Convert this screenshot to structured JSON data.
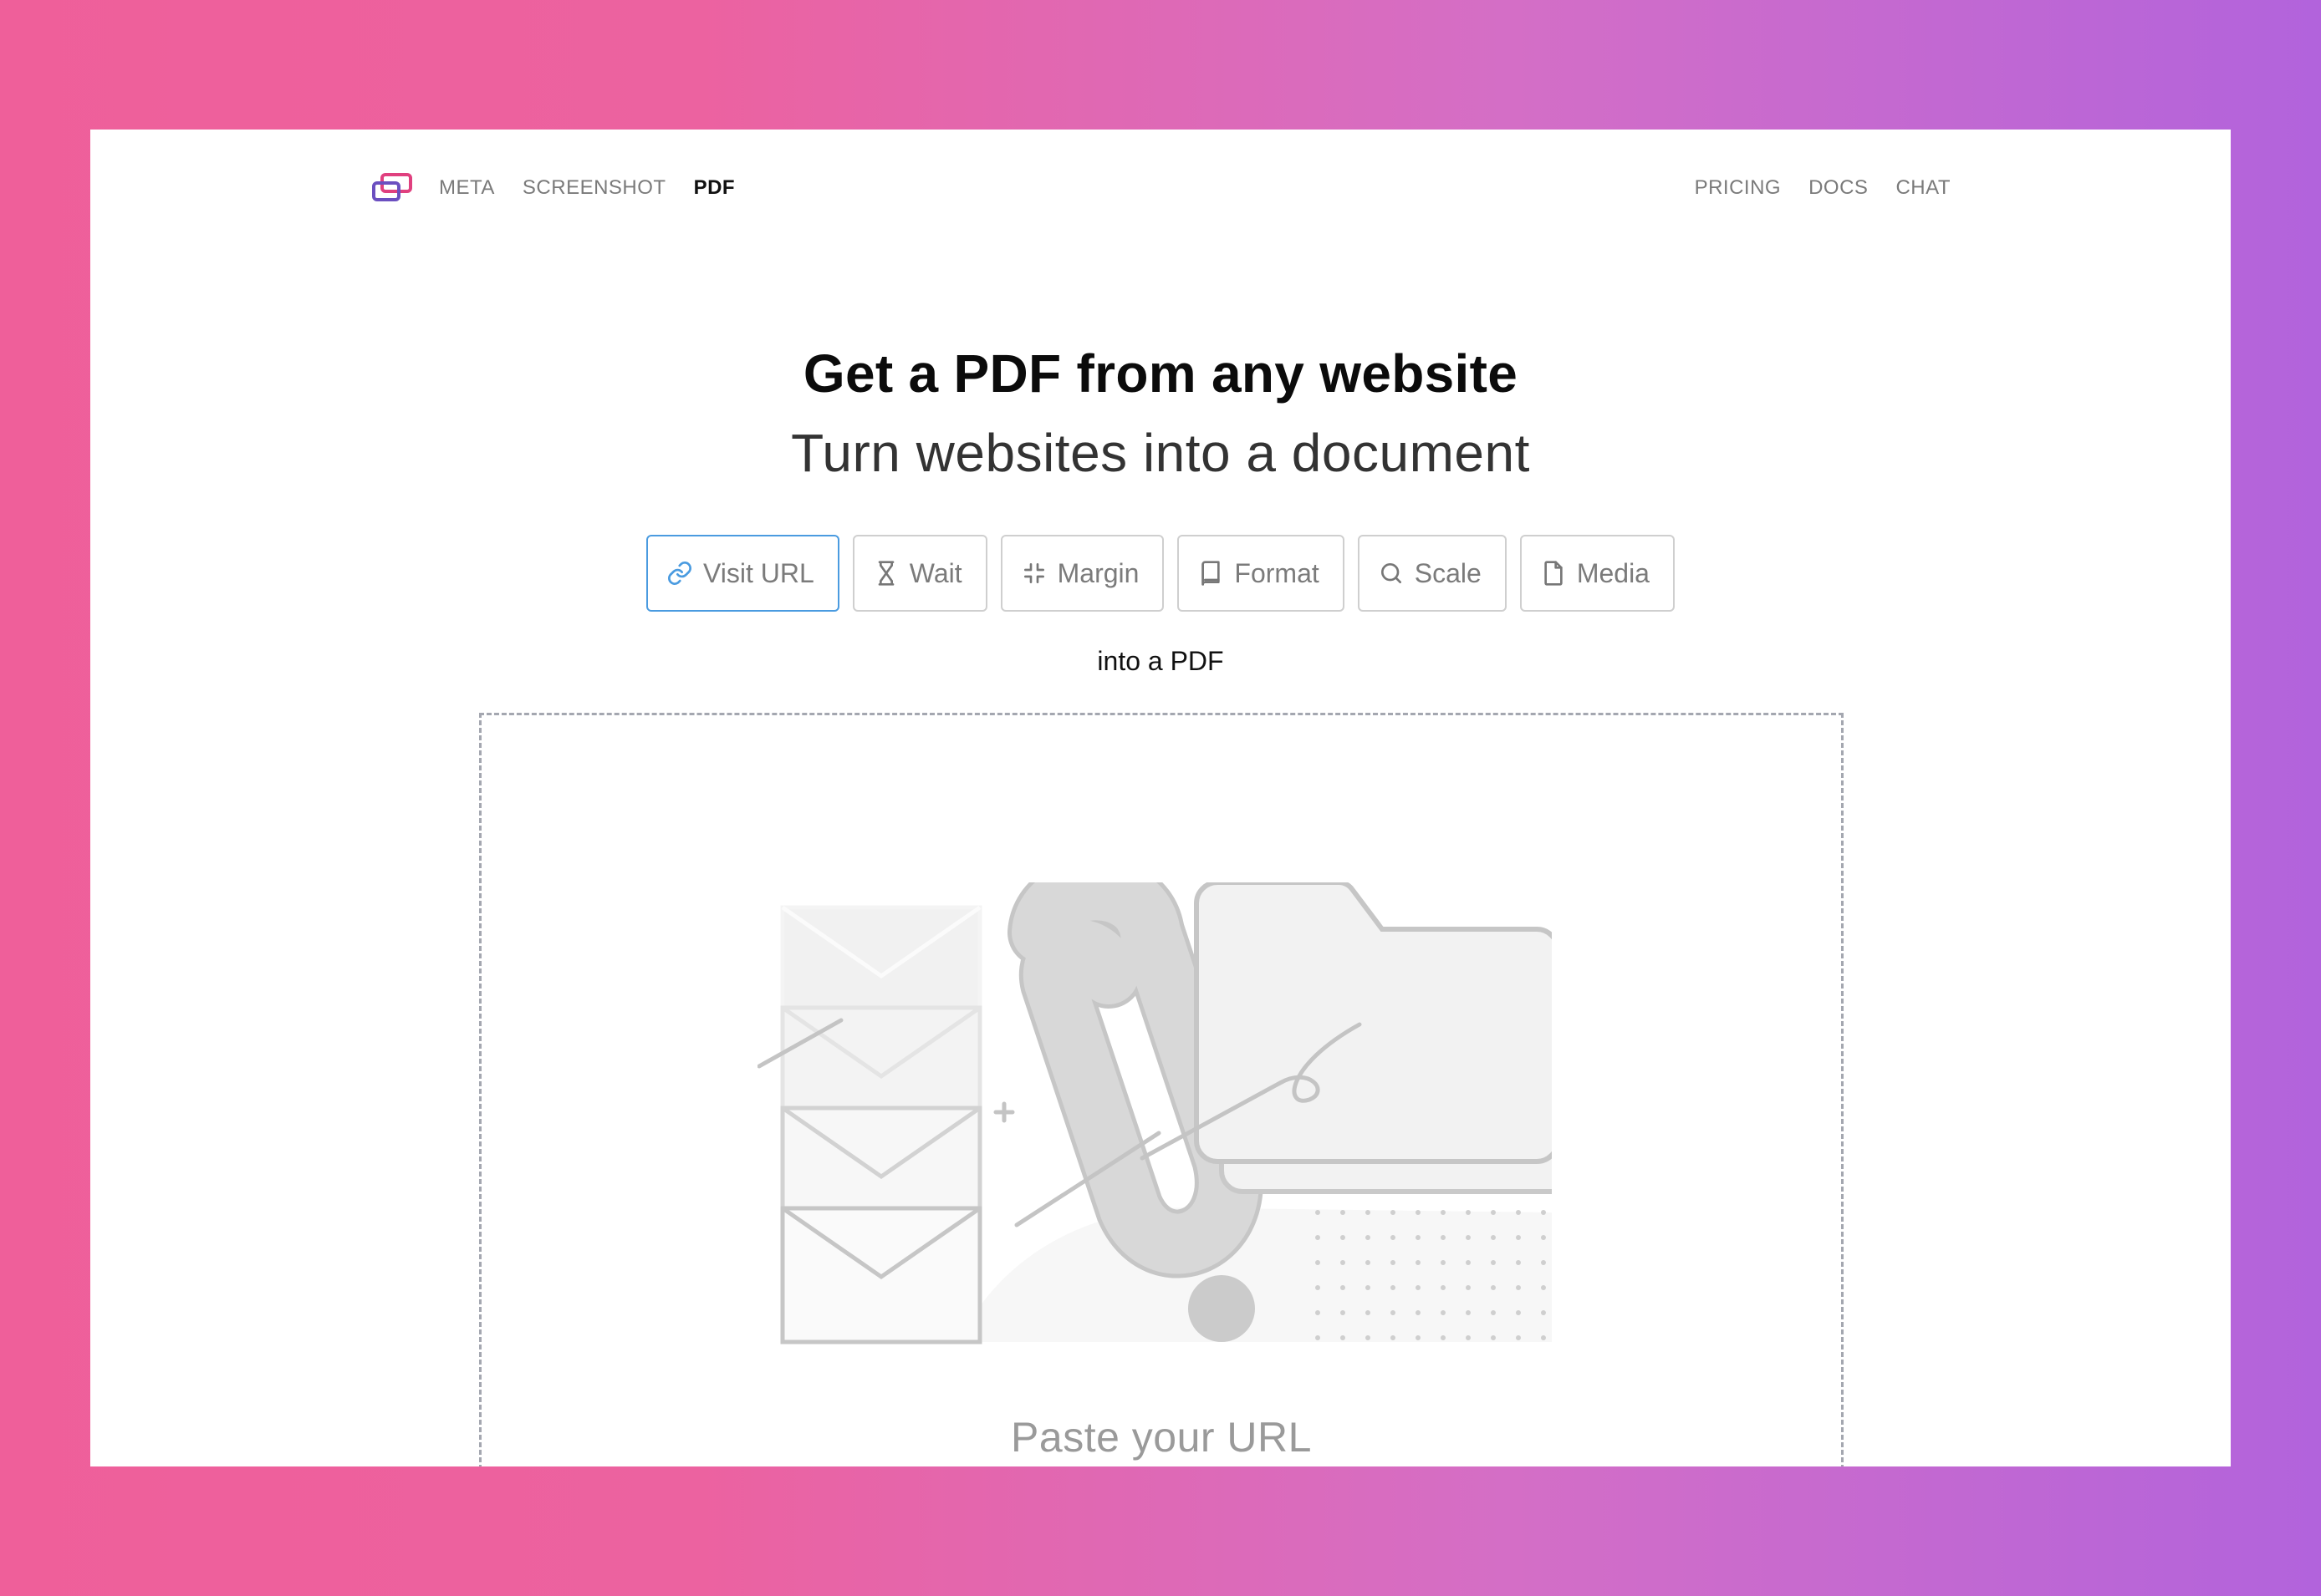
{
  "nav": {
    "left_links": [
      {
        "label": "META",
        "active": false
      },
      {
        "label": "SCREENSHOT",
        "active": false
      },
      {
        "label": "PDF",
        "active": true
      }
    ],
    "right_links": [
      {
        "label": "PRICING"
      },
      {
        "label": "DOCS"
      },
      {
        "label": "CHAT"
      }
    ]
  },
  "hero": {
    "title": "Get a PDF from any website",
    "subtitle": "Turn websites into a document"
  },
  "options": [
    {
      "label": "Visit URL",
      "icon": "link-icon",
      "active": true
    },
    {
      "label": "Wait",
      "icon": "hourglass-icon",
      "active": false
    },
    {
      "label": "Margin",
      "icon": "compress-icon",
      "active": false
    },
    {
      "label": "Format",
      "icon": "book-icon",
      "active": false
    },
    {
      "label": "Scale",
      "icon": "search-icon",
      "active": false
    },
    {
      "label": "Media",
      "icon": "file-icon",
      "active": false
    }
  ],
  "into_text": "into a PDF",
  "dropzone": {
    "placeholder": "Paste your URL"
  },
  "colors": {
    "accent_border": "#4a9be0",
    "gradient_start": "#ef5f9a",
    "gradient_end": "#b263dc"
  }
}
